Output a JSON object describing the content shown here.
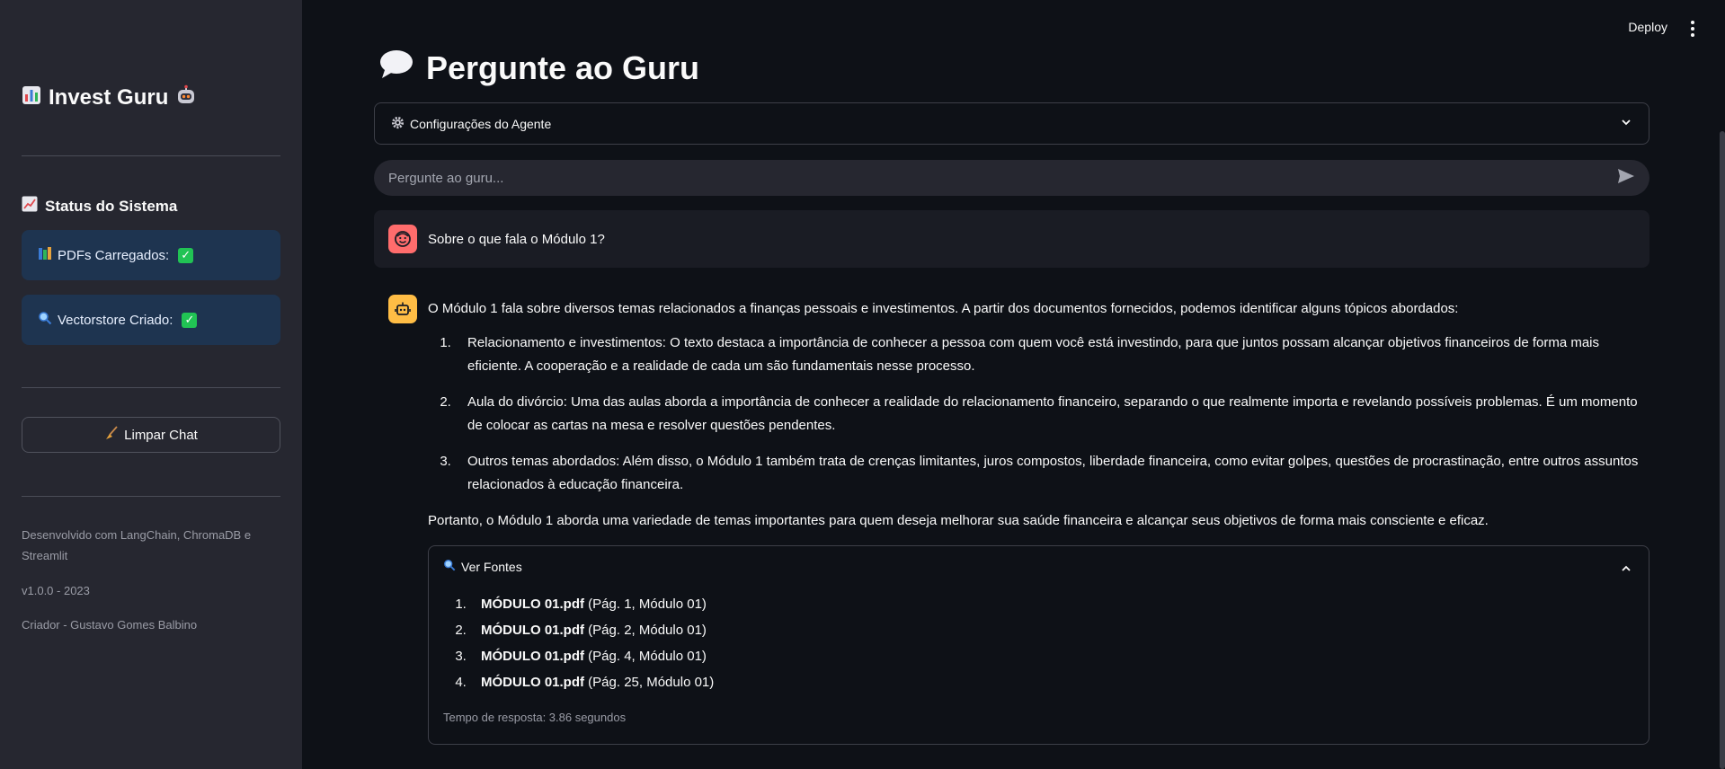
{
  "sidebar": {
    "brand": "Invest Guru",
    "status_title": "Status do Sistema",
    "status_items": [
      {
        "label": "PDFs Carregados:"
      },
      {
        "label": "Vectorstore Criado:"
      }
    ],
    "clear_button": "Limpar Chat",
    "footer": {
      "developed_with": "Desenvolvido com LangChain, ChromaDB e Streamlit",
      "version": "v1.0.0 - 2023",
      "creator": "Criador - Gustavo Gomes Balbino"
    }
  },
  "header": {
    "deploy": "Deploy"
  },
  "main": {
    "title": "Pergunte ao Guru",
    "config_expander": "Configurações do Agente",
    "chat_placeholder": "Pergunte ao guru...",
    "user_message": "Sobre o que fala o Módulo 1?",
    "bot_message": {
      "intro": "O Módulo 1 fala sobre diversos temas relacionados a finanças pessoais e investimentos. A partir dos documentos fornecidos, podemos identificar alguns tópicos abordados:",
      "points": [
        "Relacionamento e investimentos: O texto destaca a importância de conhecer a pessoa com quem você está investindo, para que juntos possam alcançar objetivos financeiros de forma mais eficiente. A cooperação e a realidade de cada um são fundamentais nesse processo.",
        "Aula do divórcio: Uma das aulas aborda a importância de conhecer a realidade do relacionamento financeiro, separando o que realmente importa e revelando possíveis problemas. É um momento de colocar as cartas na mesa e resolver questões pendentes.",
        "Outros temas abordados: Além disso, o Módulo 1 também trata de crenças limitantes, juros compostos, liberdade financeira, como evitar golpes, questões de procrastinação, entre outros assuntos relacionados à educação financeira."
      ],
      "conclusion": "Portanto, o Módulo 1 aborda uma variedade de temas importantes para quem deseja melhorar sua saúde financeira e alcançar seus objetivos de forma mais consciente e eficaz."
    },
    "sources": {
      "title": "Ver Fontes",
      "items": [
        {
          "file": "MÓDULO 01.pdf",
          "detail": "(Pág. 1, Módulo 01)"
        },
        {
          "file": "MÓDULO 01.pdf",
          "detail": "(Pág. 2, Módulo 01)"
        },
        {
          "file": "MÓDULO 01.pdf",
          "detail": "(Pág. 4, Módulo 01)"
        },
        {
          "file": "MÓDULO 01.pdf",
          "detail": "(Pág. 25, Módulo 01)"
        }
      ],
      "response_time": "Tempo de resposta: 3.86 segundos"
    }
  },
  "colors": {
    "app_bg": "#0e1117",
    "sidebar_bg": "#262730",
    "status_box_bg": "#1e3450",
    "check_green": "#21c354",
    "user_avatar": "#ff6c6c",
    "bot_avatar": "#ffbd45"
  },
  "icons": {
    "brand_left": "bar-chart-icon",
    "brand_right": "robot-icon",
    "status_title": "chart-increasing-icon",
    "pdf_status": "books-icon",
    "vector_status": "magnifier-icon",
    "clear": "broom-icon",
    "title": "speech-bubble-icon",
    "config": "gear-icon",
    "send": "send-icon",
    "sources": "magnifier-icon"
  }
}
